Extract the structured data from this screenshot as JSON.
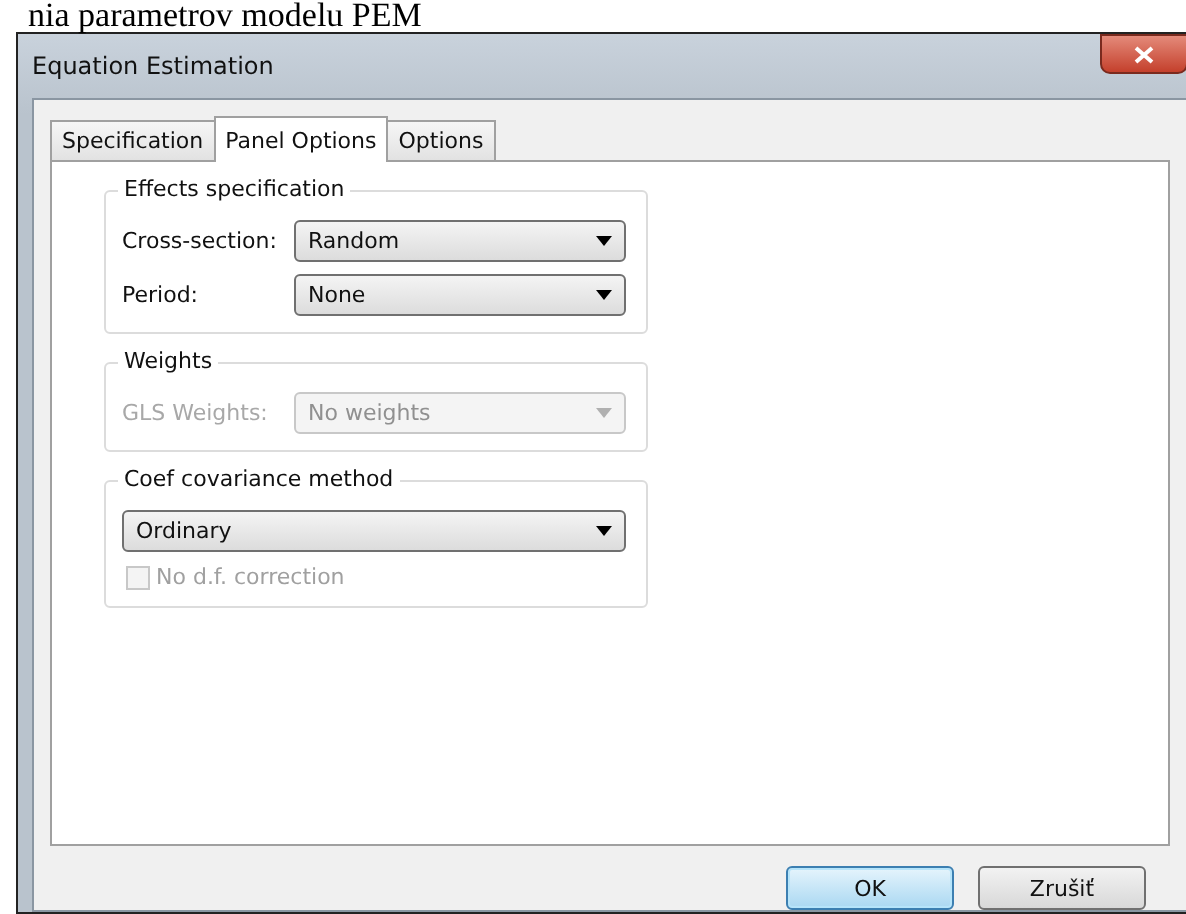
{
  "page_heading": "nia parametrov modelu PEM",
  "window": {
    "title": "Equation Estimation"
  },
  "tabs": [
    {
      "label": "Specification",
      "selected": false
    },
    {
      "label": "Panel Options",
      "selected": true
    },
    {
      "label": "Options",
      "selected": false
    }
  ],
  "groups": [
    {
      "title": "Effects specification",
      "rows": [
        {
          "kind": "dropdown",
          "label": "Cross-section:",
          "value": "Random",
          "disabled": false
        },
        {
          "kind": "dropdown",
          "label": "Period:",
          "value": "None",
          "disabled": false
        }
      ]
    },
    {
      "title": "Weights",
      "rows": [
        {
          "kind": "dropdown",
          "label": "GLS Weights:",
          "value": "No weights",
          "disabled": true
        }
      ]
    },
    {
      "title": "Coef covariance method",
      "rows": [
        {
          "kind": "dropdown",
          "value": "Ordinary",
          "disabled": false
        },
        {
          "kind": "checkbox",
          "label": "No d.f. correction",
          "checked": false,
          "disabled": true
        }
      ]
    }
  ],
  "buttons": [
    {
      "label": "OK",
      "default": true
    },
    {
      "label": "Zrušiť",
      "default": false
    }
  ]
}
